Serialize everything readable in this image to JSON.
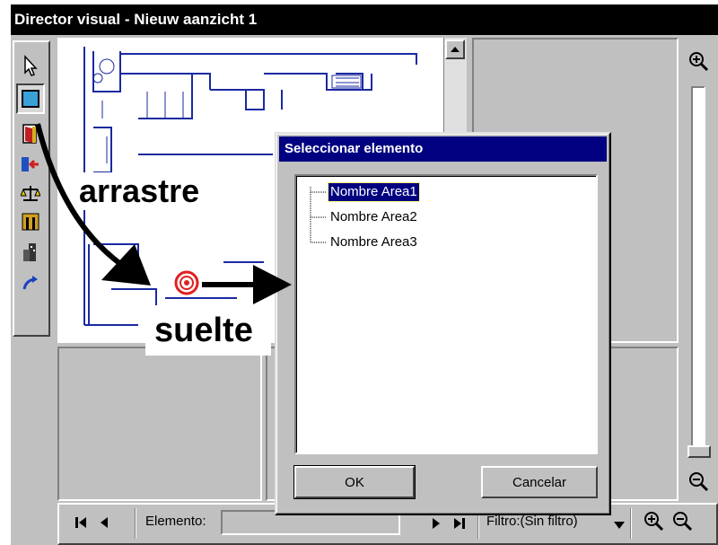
{
  "window": {
    "title": "Director visual  - Nieuw aanzicht 1"
  },
  "toolbar": {
    "tools": [
      "pointer-icon",
      "area-icon",
      "door-icon",
      "exit-door-icon",
      "scale-icon",
      "column-icon",
      "building-icon",
      "redo-arrow-icon"
    ],
    "active_tool": "area-icon"
  },
  "annotations": {
    "drag_label": "arrastre",
    "drop_label": "suelte"
  },
  "dialog": {
    "title": "Seleccionar elemento",
    "items": [
      "Nombre Area1",
      "Nombre Area2",
      "Nombre Area3"
    ],
    "selected_index": 0,
    "ok_label": "OK",
    "cancel_label": "Cancelar"
  },
  "navigator": {
    "element_label": "Elemento:",
    "element_value": "",
    "filter_label": "Filtro:(Sin filtro)"
  },
  "colors": {
    "title_bg": "#000000",
    "dialog_title_bg": "#000080",
    "selection": "#000080",
    "plan_lines": "#1a2aa0",
    "target": "#e02020"
  }
}
